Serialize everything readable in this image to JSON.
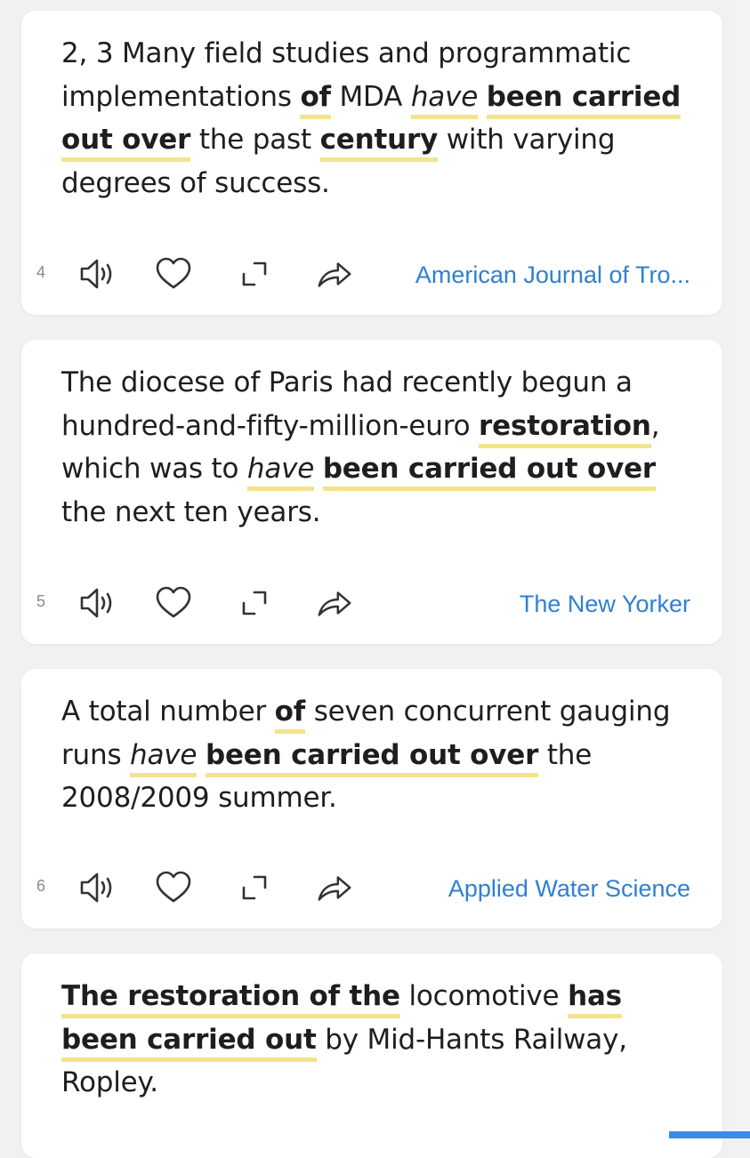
{
  "cards": [
    {
      "number": "4",
      "source": "American Journal of Tro...",
      "sentence": {
        "p1": "2, 3 Many field studies and programmatic implementations ",
        "h1": "of",
        "p2": " MDA ",
        "h2": "have",
        "p3": " ",
        "h3": "been carried out over",
        "p4": " the past ",
        "h4": "century",
        "p5": " with varying degrees of success."
      }
    },
    {
      "number": "5",
      "source": "The New Yorker",
      "sentence": {
        "p1": "The diocese of Paris had recently begun a hundred-and-fifty-million-euro ",
        "h1": "restoration",
        "p2": ", which was to ",
        "h2": "have",
        "p3": " ",
        "h3": "been carried out over",
        "p4": " the next ten years."
      }
    },
    {
      "number": "6",
      "source": "Applied Water Science",
      "sentence": {
        "p1": "A total number ",
        "h1": "of",
        "p2": " seven concurrent gauging runs ",
        "h2": "have",
        "p3": " ",
        "h3": "been carried out over",
        "p4": " the 2008/2009 summer."
      }
    },
    {
      "sentence": {
        "h1": "The restoration of the",
        "p1": " locomotive ",
        "h2": "has been carried out",
        "p2": " by Mid-Hants Railway, Ropley."
      }
    }
  ],
  "icons": {
    "speaker": "speaker-icon",
    "heart": "heart-icon",
    "expand": "expand-icon",
    "share": "share-icon"
  },
  "colors": {
    "highlight": "#f3e38e",
    "source_link": "#2f80d2",
    "scroll_indicator": "#3d8ae6"
  }
}
